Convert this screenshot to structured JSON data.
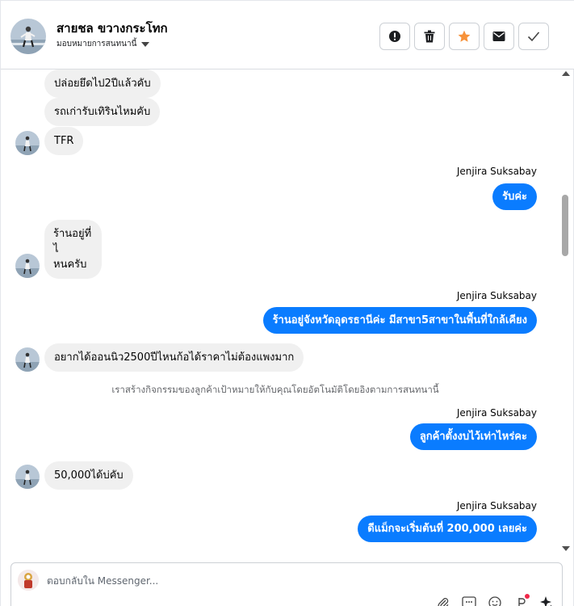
{
  "header": {
    "contact_name": "สายชล ขวางกระโทก",
    "assign_label": "มอบหมายการสนทนานี้"
  },
  "messages": [
    {
      "side": "in",
      "text": "ปล่อยยึดไป2ปีแล้วคับ"
    },
    {
      "side": "in",
      "text": "รถเก่ารับเทิรินไหมคับ"
    },
    {
      "side": "in",
      "text": "TFR"
    },
    {
      "side": "out",
      "sender": "Jenjira Suksabay",
      "text": "รับค่ะ"
    },
    {
      "side": "in",
      "lines": [
        "ร้านอยู่ที่",
        "ไ",
        "หนครับ"
      ]
    },
    {
      "side": "out",
      "sender": "Jenjira Suksabay",
      "text": "ร้านอยู่จังหวัดอุดรธานีค่ะ มีสาขา5สาขาในพื้นที่ใกล้เคียง"
    },
    {
      "side": "in",
      "text": "อยากได้ออนนิว2500ปีไหนก้อได้ราคาไม่ต้องแพงมาก"
    },
    {
      "side": "system",
      "text": "เราสร้างกิจกรรมของลูกค้าเป้าหมายให้กับคุณโดยอัตโนมัติโดยอิงตามการสนทนานี้"
    },
    {
      "side": "out",
      "sender": "Jenjira Suksabay",
      "text": "ลูกค้าตั้งงบไว้เท่าไหร่คะ"
    },
    {
      "side": "in",
      "text": "50,000ได้บ่คับ"
    },
    {
      "side": "out",
      "sender": "Jenjira Suksabay",
      "text": "ดีแม็กจะเริ่มต้นที่ 200,000 เลยค่ะ"
    }
  ],
  "composer": {
    "placeholder": "ตอบกลับใน Messenger..."
  },
  "icons": {
    "actions": [
      "alert-icon",
      "trash-icon",
      "star-icon",
      "envelope-icon",
      "check-icon"
    ],
    "tools": [
      "paperclip-icon",
      "saved-replies-icon",
      "emoji-icon",
      "currency-icon",
      "sparkle-icon"
    ]
  },
  "colors": {
    "outgoing_bubble": "#0a7cff",
    "incoming_bubble": "#f0f0f0",
    "star": "#f7923a"
  }
}
